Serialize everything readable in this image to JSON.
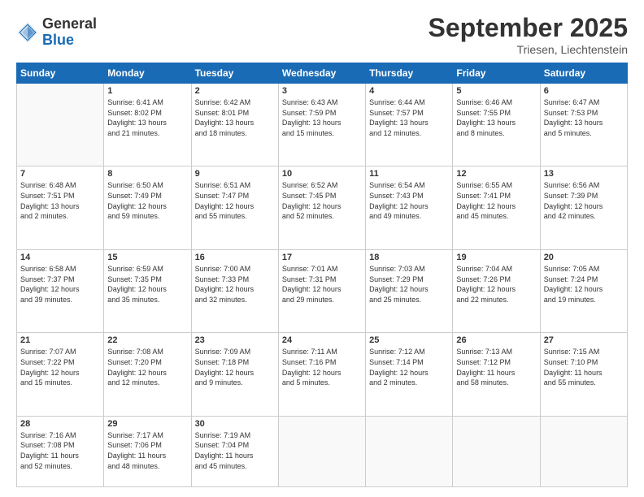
{
  "logo": {
    "general": "General",
    "blue": "Blue"
  },
  "header": {
    "month": "September 2025",
    "location": "Triesen, Liechtenstein"
  },
  "weekdays": [
    "Sunday",
    "Monday",
    "Tuesday",
    "Wednesday",
    "Thursday",
    "Friday",
    "Saturday"
  ],
  "weeks": [
    [
      {
        "num": "",
        "info": ""
      },
      {
        "num": "1",
        "info": "Sunrise: 6:41 AM\nSunset: 8:02 PM\nDaylight: 13 hours\nand 21 minutes."
      },
      {
        "num": "2",
        "info": "Sunrise: 6:42 AM\nSunset: 8:01 PM\nDaylight: 13 hours\nand 18 minutes."
      },
      {
        "num": "3",
        "info": "Sunrise: 6:43 AM\nSunset: 7:59 PM\nDaylight: 13 hours\nand 15 minutes."
      },
      {
        "num": "4",
        "info": "Sunrise: 6:44 AM\nSunset: 7:57 PM\nDaylight: 13 hours\nand 12 minutes."
      },
      {
        "num": "5",
        "info": "Sunrise: 6:46 AM\nSunset: 7:55 PM\nDaylight: 13 hours\nand 8 minutes."
      },
      {
        "num": "6",
        "info": "Sunrise: 6:47 AM\nSunset: 7:53 PM\nDaylight: 13 hours\nand 5 minutes."
      }
    ],
    [
      {
        "num": "7",
        "info": "Sunrise: 6:48 AM\nSunset: 7:51 PM\nDaylight: 13 hours\nand 2 minutes."
      },
      {
        "num": "8",
        "info": "Sunrise: 6:50 AM\nSunset: 7:49 PM\nDaylight: 12 hours\nand 59 minutes."
      },
      {
        "num": "9",
        "info": "Sunrise: 6:51 AM\nSunset: 7:47 PM\nDaylight: 12 hours\nand 55 minutes."
      },
      {
        "num": "10",
        "info": "Sunrise: 6:52 AM\nSunset: 7:45 PM\nDaylight: 12 hours\nand 52 minutes."
      },
      {
        "num": "11",
        "info": "Sunrise: 6:54 AM\nSunset: 7:43 PM\nDaylight: 12 hours\nand 49 minutes."
      },
      {
        "num": "12",
        "info": "Sunrise: 6:55 AM\nSunset: 7:41 PM\nDaylight: 12 hours\nand 45 minutes."
      },
      {
        "num": "13",
        "info": "Sunrise: 6:56 AM\nSunset: 7:39 PM\nDaylight: 12 hours\nand 42 minutes."
      }
    ],
    [
      {
        "num": "14",
        "info": "Sunrise: 6:58 AM\nSunset: 7:37 PM\nDaylight: 12 hours\nand 39 minutes."
      },
      {
        "num": "15",
        "info": "Sunrise: 6:59 AM\nSunset: 7:35 PM\nDaylight: 12 hours\nand 35 minutes."
      },
      {
        "num": "16",
        "info": "Sunrise: 7:00 AM\nSunset: 7:33 PM\nDaylight: 12 hours\nand 32 minutes."
      },
      {
        "num": "17",
        "info": "Sunrise: 7:01 AM\nSunset: 7:31 PM\nDaylight: 12 hours\nand 29 minutes."
      },
      {
        "num": "18",
        "info": "Sunrise: 7:03 AM\nSunset: 7:29 PM\nDaylight: 12 hours\nand 25 minutes."
      },
      {
        "num": "19",
        "info": "Sunrise: 7:04 AM\nSunset: 7:26 PM\nDaylight: 12 hours\nand 22 minutes."
      },
      {
        "num": "20",
        "info": "Sunrise: 7:05 AM\nSunset: 7:24 PM\nDaylight: 12 hours\nand 19 minutes."
      }
    ],
    [
      {
        "num": "21",
        "info": "Sunrise: 7:07 AM\nSunset: 7:22 PM\nDaylight: 12 hours\nand 15 minutes."
      },
      {
        "num": "22",
        "info": "Sunrise: 7:08 AM\nSunset: 7:20 PM\nDaylight: 12 hours\nand 12 minutes."
      },
      {
        "num": "23",
        "info": "Sunrise: 7:09 AM\nSunset: 7:18 PM\nDaylight: 12 hours\nand 9 minutes."
      },
      {
        "num": "24",
        "info": "Sunrise: 7:11 AM\nSunset: 7:16 PM\nDaylight: 12 hours\nand 5 minutes."
      },
      {
        "num": "25",
        "info": "Sunrise: 7:12 AM\nSunset: 7:14 PM\nDaylight: 12 hours\nand 2 minutes."
      },
      {
        "num": "26",
        "info": "Sunrise: 7:13 AM\nSunset: 7:12 PM\nDaylight: 11 hours\nand 58 minutes."
      },
      {
        "num": "27",
        "info": "Sunrise: 7:15 AM\nSunset: 7:10 PM\nDaylight: 11 hours\nand 55 minutes."
      }
    ],
    [
      {
        "num": "28",
        "info": "Sunrise: 7:16 AM\nSunset: 7:08 PM\nDaylight: 11 hours\nand 52 minutes."
      },
      {
        "num": "29",
        "info": "Sunrise: 7:17 AM\nSunset: 7:06 PM\nDaylight: 11 hours\nand 48 minutes."
      },
      {
        "num": "30",
        "info": "Sunrise: 7:19 AM\nSunset: 7:04 PM\nDaylight: 11 hours\nand 45 minutes."
      },
      {
        "num": "",
        "info": ""
      },
      {
        "num": "",
        "info": ""
      },
      {
        "num": "",
        "info": ""
      },
      {
        "num": "",
        "info": ""
      }
    ]
  ]
}
